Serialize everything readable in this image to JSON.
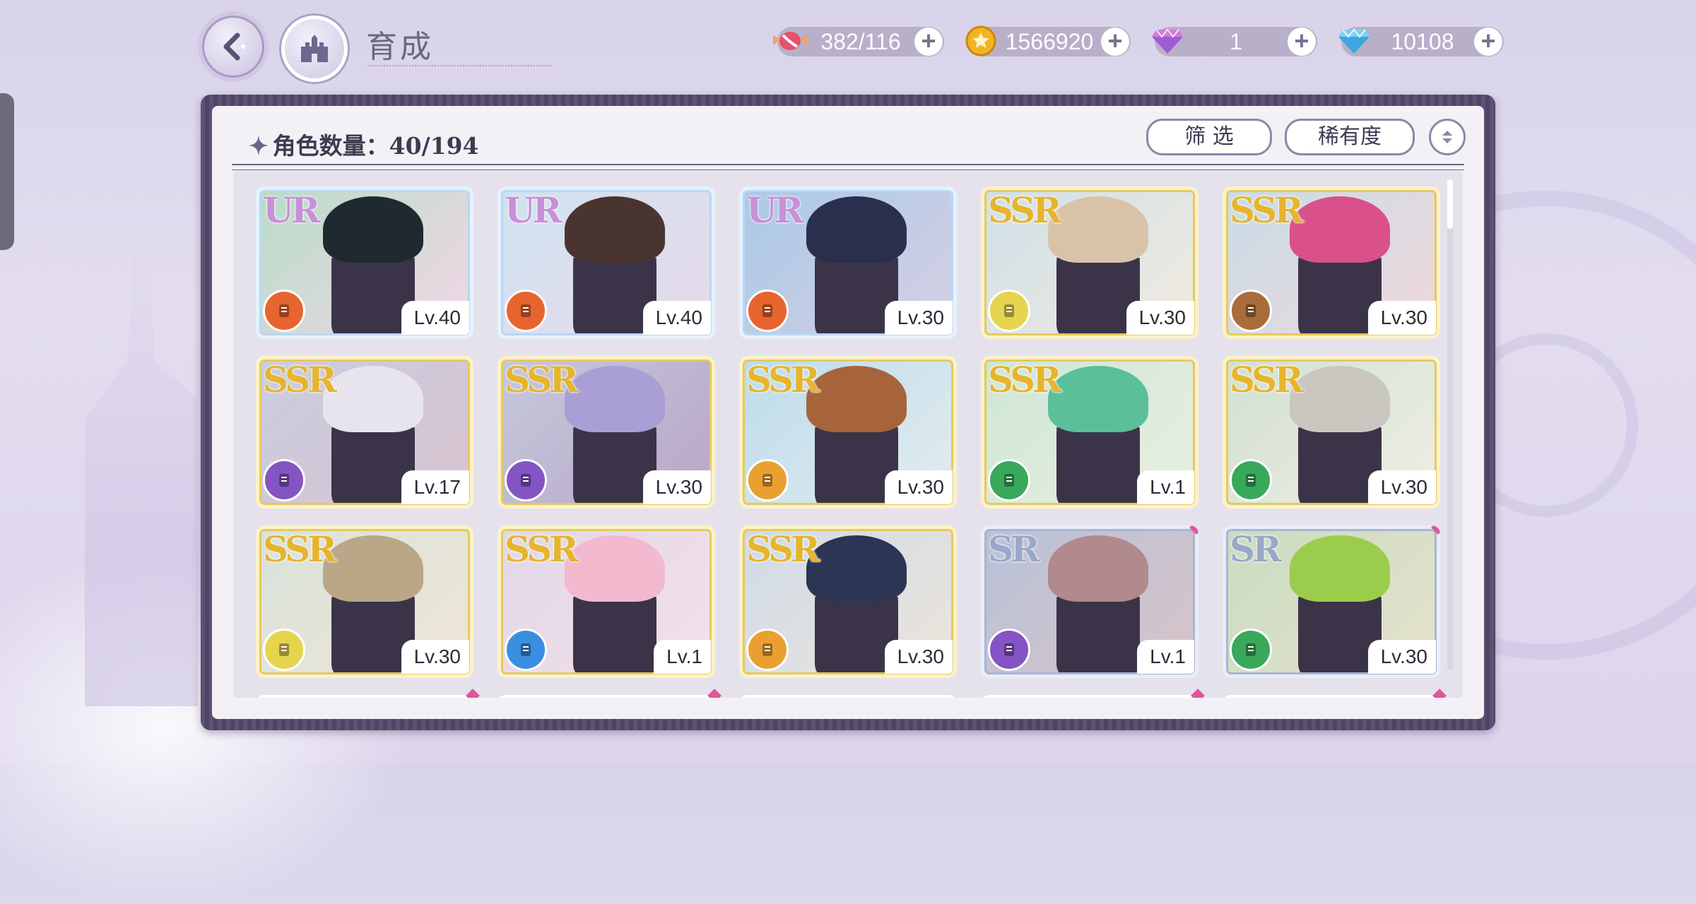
{
  "header": {
    "title": "育成"
  },
  "resources": [
    {
      "name": "stamina",
      "icon": "candy-icon",
      "value": "382/116"
    },
    {
      "name": "gold",
      "icon": "gold-coin-icon",
      "value": "1566920"
    },
    {
      "name": "pink-gem",
      "icon": "pink-diamond-icon",
      "value": "1"
    },
    {
      "name": "diamond",
      "icon": "blue-diamond-icon",
      "value": "10108"
    }
  ],
  "panel": {
    "count_label": "角色数量：40/194",
    "filter_label": "筛 选",
    "rarity_label": "稀有度"
  },
  "colors": {
    "UR": "#c98fd8",
    "SSR": "#e6b52d",
    "SR": "#9aa8c9",
    "panel": "#4e4466",
    "accent": "#e0569a"
  },
  "cards": [
    {
      "rarity": "UR",
      "level": "Lv.40",
      "type_color": "#e8642e",
      "type_icon": "orange-hammer-icon",
      "art": [
        "#b8dcc8",
        "#f2d7e6"
      ],
      "hair": "#1e2a30",
      "skin": "#f4ddd0",
      "gem": false
    },
    {
      "rarity": "UR",
      "level": "Lv.40",
      "type_color": "#e8642e",
      "type_icon": "orange-book-icon",
      "art": [
        "#cfe3ef",
        "#e7d9ea"
      ],
      "hair": "#4a3430",
      "skin": "#f4ddd0",
      "gem": false
    },
    {
      "rarity": "UR",
      "level": "Lv.30",
      "type_color": "#e8642e",
      "type_icon": "orange-fist-icon",
      "art": [
        "#a9c9e6",
        "#d6cfe4"
      ],
      "hair": "#2a2f4e",
      "skin": "#c89a78",
      "gem": false
    },
    {
      "rarity": "SSR",
      "level": "Lv.30",
      "type_color": "#e7d44e",
      "type_icon": "yellow-wrench-icon",
      "art": [
        "#cfe0e8",
        "#f1eadf"
      ],
      "hair": "#d8c3a8",
      "skin": "#f6e3d6",
      "gem": false
    },
    {
      "rarity": "SSR",
      "level": "Lv.30",
      "type_color": "#a86d3a",
      "type_icon": "brown-boot-icon",
      "art": [
        "#c9dbe6",
        "#efd8dc"
      ],
      "hair": "#d9508a",
      "skin": "#f6e0d6",
      "gem": false
    },
    {
      "rarity": "SSR",
      "level": "Lv.17",
      "type_color": "#8454c4",
      "type_icon": "purple-boot-icon",
      "art": [
        "#c9cde0",
        "#d8c4cf"
      ],
      "hair": "#e7e4ee",
      "skin": "#f0dcd4",
      "gem": false
    },
    {
      "rarity": "SSR",
      "level": "Lv.30",
      "type_color": "#8454c4",
      "type_icon": "purple-fist-icon",
      "art": [
        "#c4c8dc",
        "#b9a6c6"
      ],
      "hair": "#a99fd6",
      "skin": "#efdcd2",
      "gem": false
    },
    {
      "rarity": "SSR",
      "level": "Lv.30",
      "type_color": "#eaa030",
      "type_icon": "orange-book-icon",
      "art": [
        "#bcdcec",
        "#e3ecee"
      ],
      "hair": "#a7643a",
      "skin": "#f4ddd0",
      "gem": false
    },
    {
      "rarity": "SSR",
      "level": "Lv.1",
      "type_color": "#3aa85a",
      "type_icon": "green-boot-icon",
      "art": [
        "#cfe6d6",
        "#e8efe0"
      ],
      "hair": "#5bbf9a",
      "skin": "#f3ddd2",
      "gem": false
    },
    {
      "rarity": "SSR",
      "level": "Lv.30",
      "type_color": "#3aa85a",
      "type_icon": "green-wrench-icon",
      "art": [
        "#d2e0d0",
        "#eeeee6"
      ],
      "hair": "#c9c7c0",
      "skin": "#f1ddd0",
      "gem": false
    },
    {
      "rarity": "SSR",
      "level": "Lv.30",
      "type_color": "#e7d44e",
      "type_icon": "yellow-book-icon",
      "art": [
        "#d9e2dc",
        "#efe6d6"
      ],
      "hair": "#b9a788",
      "skin": "#f1ddd0",
      "gem": false
    },
    {
      "rarity": "SSR",
      "level": "Lv.1",
      "type_color": "#3a8ee0",
      "type_icon": "blue-wrench-icon",
      "art": [
        "#e0d8e6",
        "#f4e0ea"
      ],
      "hair": "#f2b9cf",
      "skin": "#f8e4dc",
      "gem": false
    },
    {
      "rarity": "SSR",
      "level": "Lv.30",
      "type_color": "#eaa030",
      "type_icon": "orange-book-icon",
      "art": [
        "#cfdbe8",
        "#ece4da"
      ],
      "hair": "#2c3554",
      "skin": "#f3dcd0",
      "gem": false
    },
    {
      "rarity": "SR",
      "level": "Lv.1",
      "type_color": "#8454c4",
      "type_icon": "purple-boot-icon",
      "art": [
        "#b8c2d8",
        "#d8c4c8"
      ],
      "hair": "#b08a8c",
      "skin": "#f2dcd4",
      "gem": true
    },
    {
      "rarity": "SR",
      "level": "Lv.30",
      "type_color": "#3aa85a",
      "type_icon": "green-shield-icon",
      "art": [
        "#c8dcc0",
        "#e6e2cc"
      ],
      "hair": "#9ccc4c",
      "skin": "#f4ddd0",
      "gem": true
    }
  ],
  "partial_row_gems": [
    true,
    true,
    false,
    true,
    true
  ]
}
